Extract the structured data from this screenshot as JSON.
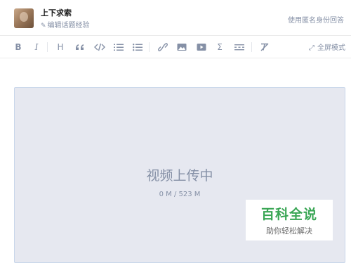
{
  "header": {
    "user_name": "上下求索",
    "edit_experience": "编辑话题经验",
    "anonymous_answer": "使用匿名身份回答"
  },
  "toolbar": {
    "items": [
      "bold",
      "italic",
      "heading",
      "quote",
      "code-block",
      "ordered-list",
      "unordered-list",
      "link",
      "image",
      "video",
      "formula",
      "divider",
      "clear-format"
    ],
    "bold_label": "B",
    "italic_label": "I",
    "heading_label": "H",
    "formula_label": "Σ",
    "fullscreen_label": "全屏模式"
  },
  "upload": {
    "title": "视频上传中",
    "progress": "0 M / 523 M"
  },
  "watermark": {
    "main": "百科全说",
    "sub": "助你轻松解决"
  },
  "colors": {
    "icon": "#8590a6",
    "upload_bg": "#e6e8f0",
    "upload_border": "#c8d6ea",
    "watermark_green": "#3aa655"
  }
}
